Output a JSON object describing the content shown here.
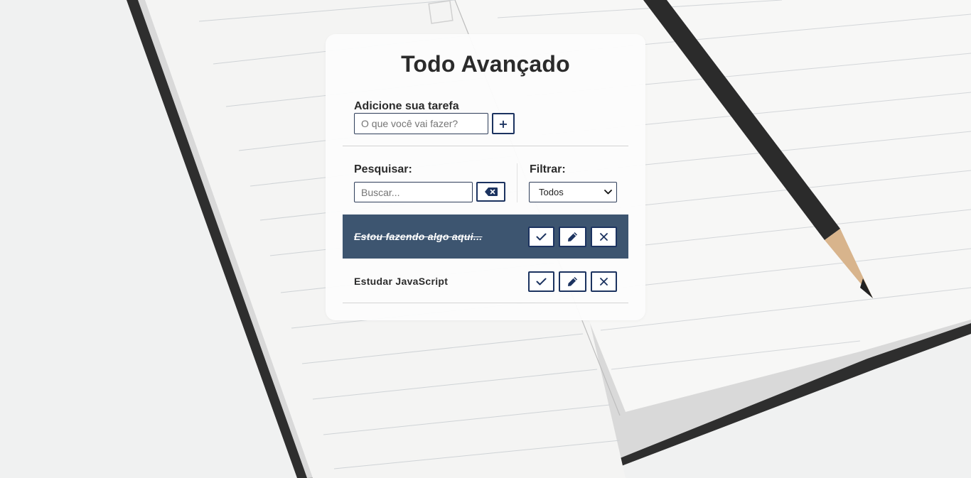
{
  "app": {
    "title": "Todo Avançado"
  },
  "add_section": {
    "label": "Adicione sua tarefa",
    "input_placeholder": "O que você vai fazer?",
    "input_value": "",
    "add_button_label": "+"
  },
  "search_section": {
    "label": "Pesquisar:",
    "input_placeholder": "Buscar...",
    "input_value": "",
    "clear_icon": "backspace-icon"
  },
  "filter_section": {
    "label": "Filtrar:",
    "selected": "Todos",
    "dropdown_icon": "chevron-down-icon"
  },
  "todos": [
    {
      "text": "Estou fazendo algo aqui...",
      "done": true,
      "actions": [
        "check-icon",
        "pencil-icon",
        "close-icon"
      ]
    },
    {
      "text": "Estudar JavaScript",
      "done": false,
      "actions": [
        "check-icon",
        "pencil-icon",
        "close-icon"
      ]
    }
  ],
  "colors": {
    "accent": "#1c3360",
    "done_row_bg": "#3d5570",
    "card_bg": "#fcfcfc",
    "text": "#2b2b2b"
  }
}
